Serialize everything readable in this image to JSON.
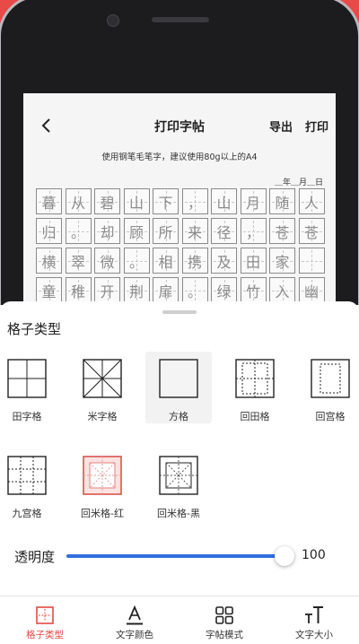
{
  "header": {
    "title": "打印字帖",
    "export_label": "导出",
    "print_label": "打印"
  },
  "tip": "使用钢笔毛笔字，建议使用80g以上的A4",
  "date_line": "＿年＿月＿日",
  "practice_grid": {
    "rows": [
      [
        "暮",
        "从",
        "碧",
        "山",
        "下",
        "，",
        "山",
        "月",
        "随",
        "人"
      ],
      [
        "归",
        "。",
        "却",
        "顾",
        "所",
        "来",
        "径",
        "，",
        "苍",
        "苍"
      ],
      [
        "横",
        "翠",
        "微",
        "。",
        "相",
        "携",
        "及",
        "田",
        "家",
        ""
      ],
      [
        "童",
        "稚",
        "开",
        "荆",
        "扉",
        "。",
        "绿",
        "竹",
        "入",
        "幽"
      ]
    ]
  },
  "sheet": {
    "title": "格子类型",
    "options": [
      {
        "label": "田字格",
        "icon": "tian-grid-icon"
      },
      {
        "label": "米字格",
        "icon": "mi-grid-icon"
      },
      {
        "label": "方格",
        "icon": "square-grid-icon",
        "selected": true
      },
      {
        "label": "回田格",
        "icon": "hui-tian-grid-icon"
      },
      {
        "label": "回宫格",
        "icon": "hui-gong-grid-icon"
      },
      {
        "label": "九宫格",
        "icon": "nine-grid-icon"
      },
      {
        "label": "回米格-红",
        "icon": "hui-mi-red-grid-icon"
      },
      {
        "label": "回米格-黑",
        "icon": "hui-mi-black-grid-icon"
      }
    ],
    "opacity": {
      "label": "透明度",
      "value": 100,
      "max": 100
    }
  },
  "tabs": [
    {
      "label": "格子类型",
      "icon": "grid-type-icon",
      "active": true
    },
    {
      "label": "文字颜色",
      "icon": "text-color-icon"
    },
    {
      "label": "字帖模式",
      "icon": "copybook-mode-icon"
    },
    {
      "label": "文字大小",
      "icon": "text-size-icon"
    }
  ],
  "colors": {
    "accent": "#e24a43",
    "slider": "#2f6fdc",
    "promo_bg": "#e43f3d"
  }
}
